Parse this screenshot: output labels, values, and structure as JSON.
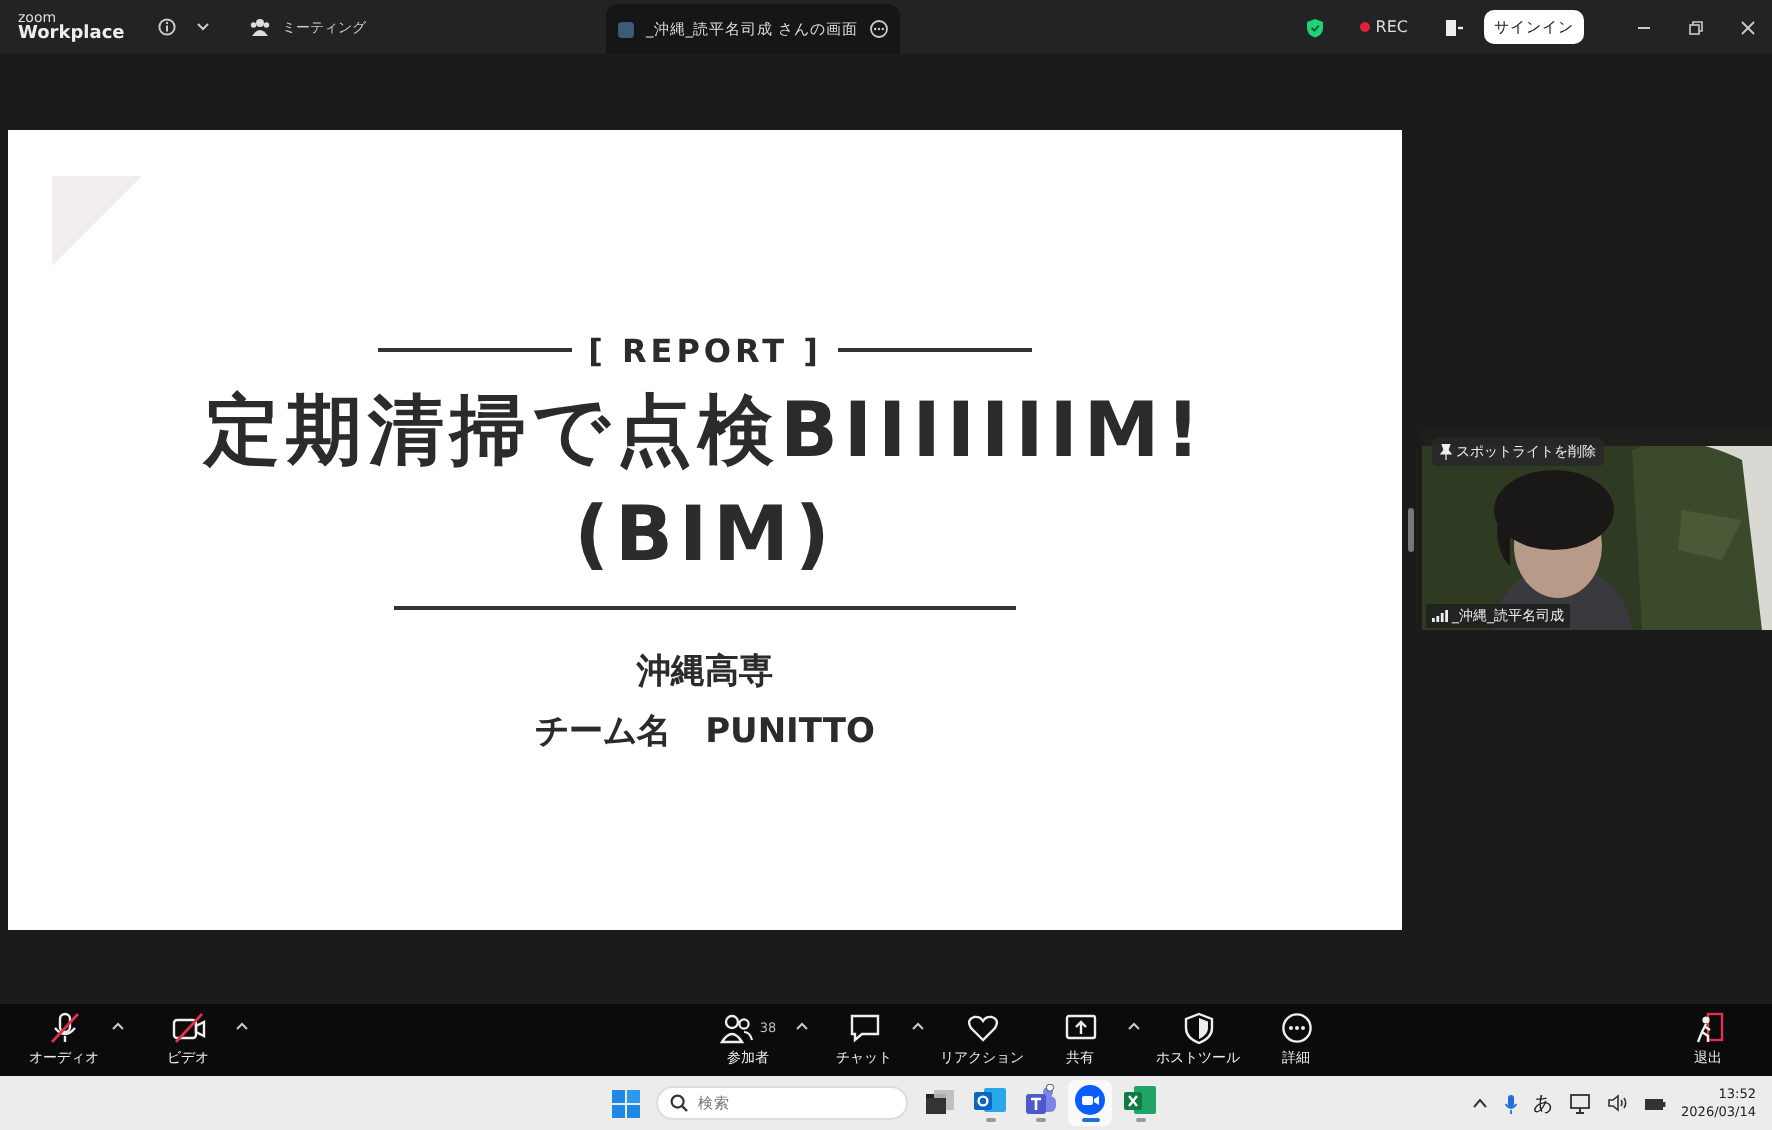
{
  "titlebar": {
    "logo_top": "zoom",
    "logo_bottom": "Workplace",
    "meeting_label": "ミーティング",
    "share_tab": "_沖縄_読平名司成 さんの画面",
    "rec": "REC",
    "signin": "サインイン"
  },
  "slide": {
    "tag": "[ REPORT ]",
    "title_lines": [
      "定期清掃で点検BIIIIIIIM!",
      "(BIM)"
    ],
    "school": "沖縄高専",
    "team": "チーム名　PUNITTO"
  },
  "video": {
    "spotlight": "スポットライトを削除",
    "name": "_沖縄_読平名司成"
  },
  "toolbar": {
    "left": [
      {
        "kind": "audio",
        "label": "オーディオ",
        "muted": true,
        "caret": true
      },
      {
        "kind": "video",
        "label": "ビデオ",
        "muted": true,
        "caret": true
      }
    ],
    "center": [
      {
        "kind": "participants",
        "label": "参加者",
        "count": "38",
        "caret": true
      },
      {
        "kind": "chat",
        "label": "チャット",
        "caret": true
      },
      {
        "kind": "reaction",
        "label": "リアクション",
        "caret": false
      },
      {
        "kind": "share",
        "label": "共有",
        "caret": true
      },
      {
        "kind": "host",
        "label": "ホストツール",
        "caret": false
      },
      {
        "kind": "more",
        "label": "詳細",
        "caret": false
      }
    ],
    "right": [
      {
        "kind": "leave",
        "label": "退出",
        "caret": false
      }
    ]
  },
  "taskbar": {
    "search_placeholder": "検索",
    "apps": [
      {
        "kind": "taskview",
        "selected": false
      },
      {
        "kind": "outlook",
        "selected": false
      },
      {
        "kind": "teams",
        "selected": false
      },
      {
        "kind": "zoom",
        "selected": true
      },
      {
        "kind": "excel",
        "selected": false
      }
    ],
    "ime": "あ",
    "time": "13:52",
    "date": "2026/03/14"
  }
}
